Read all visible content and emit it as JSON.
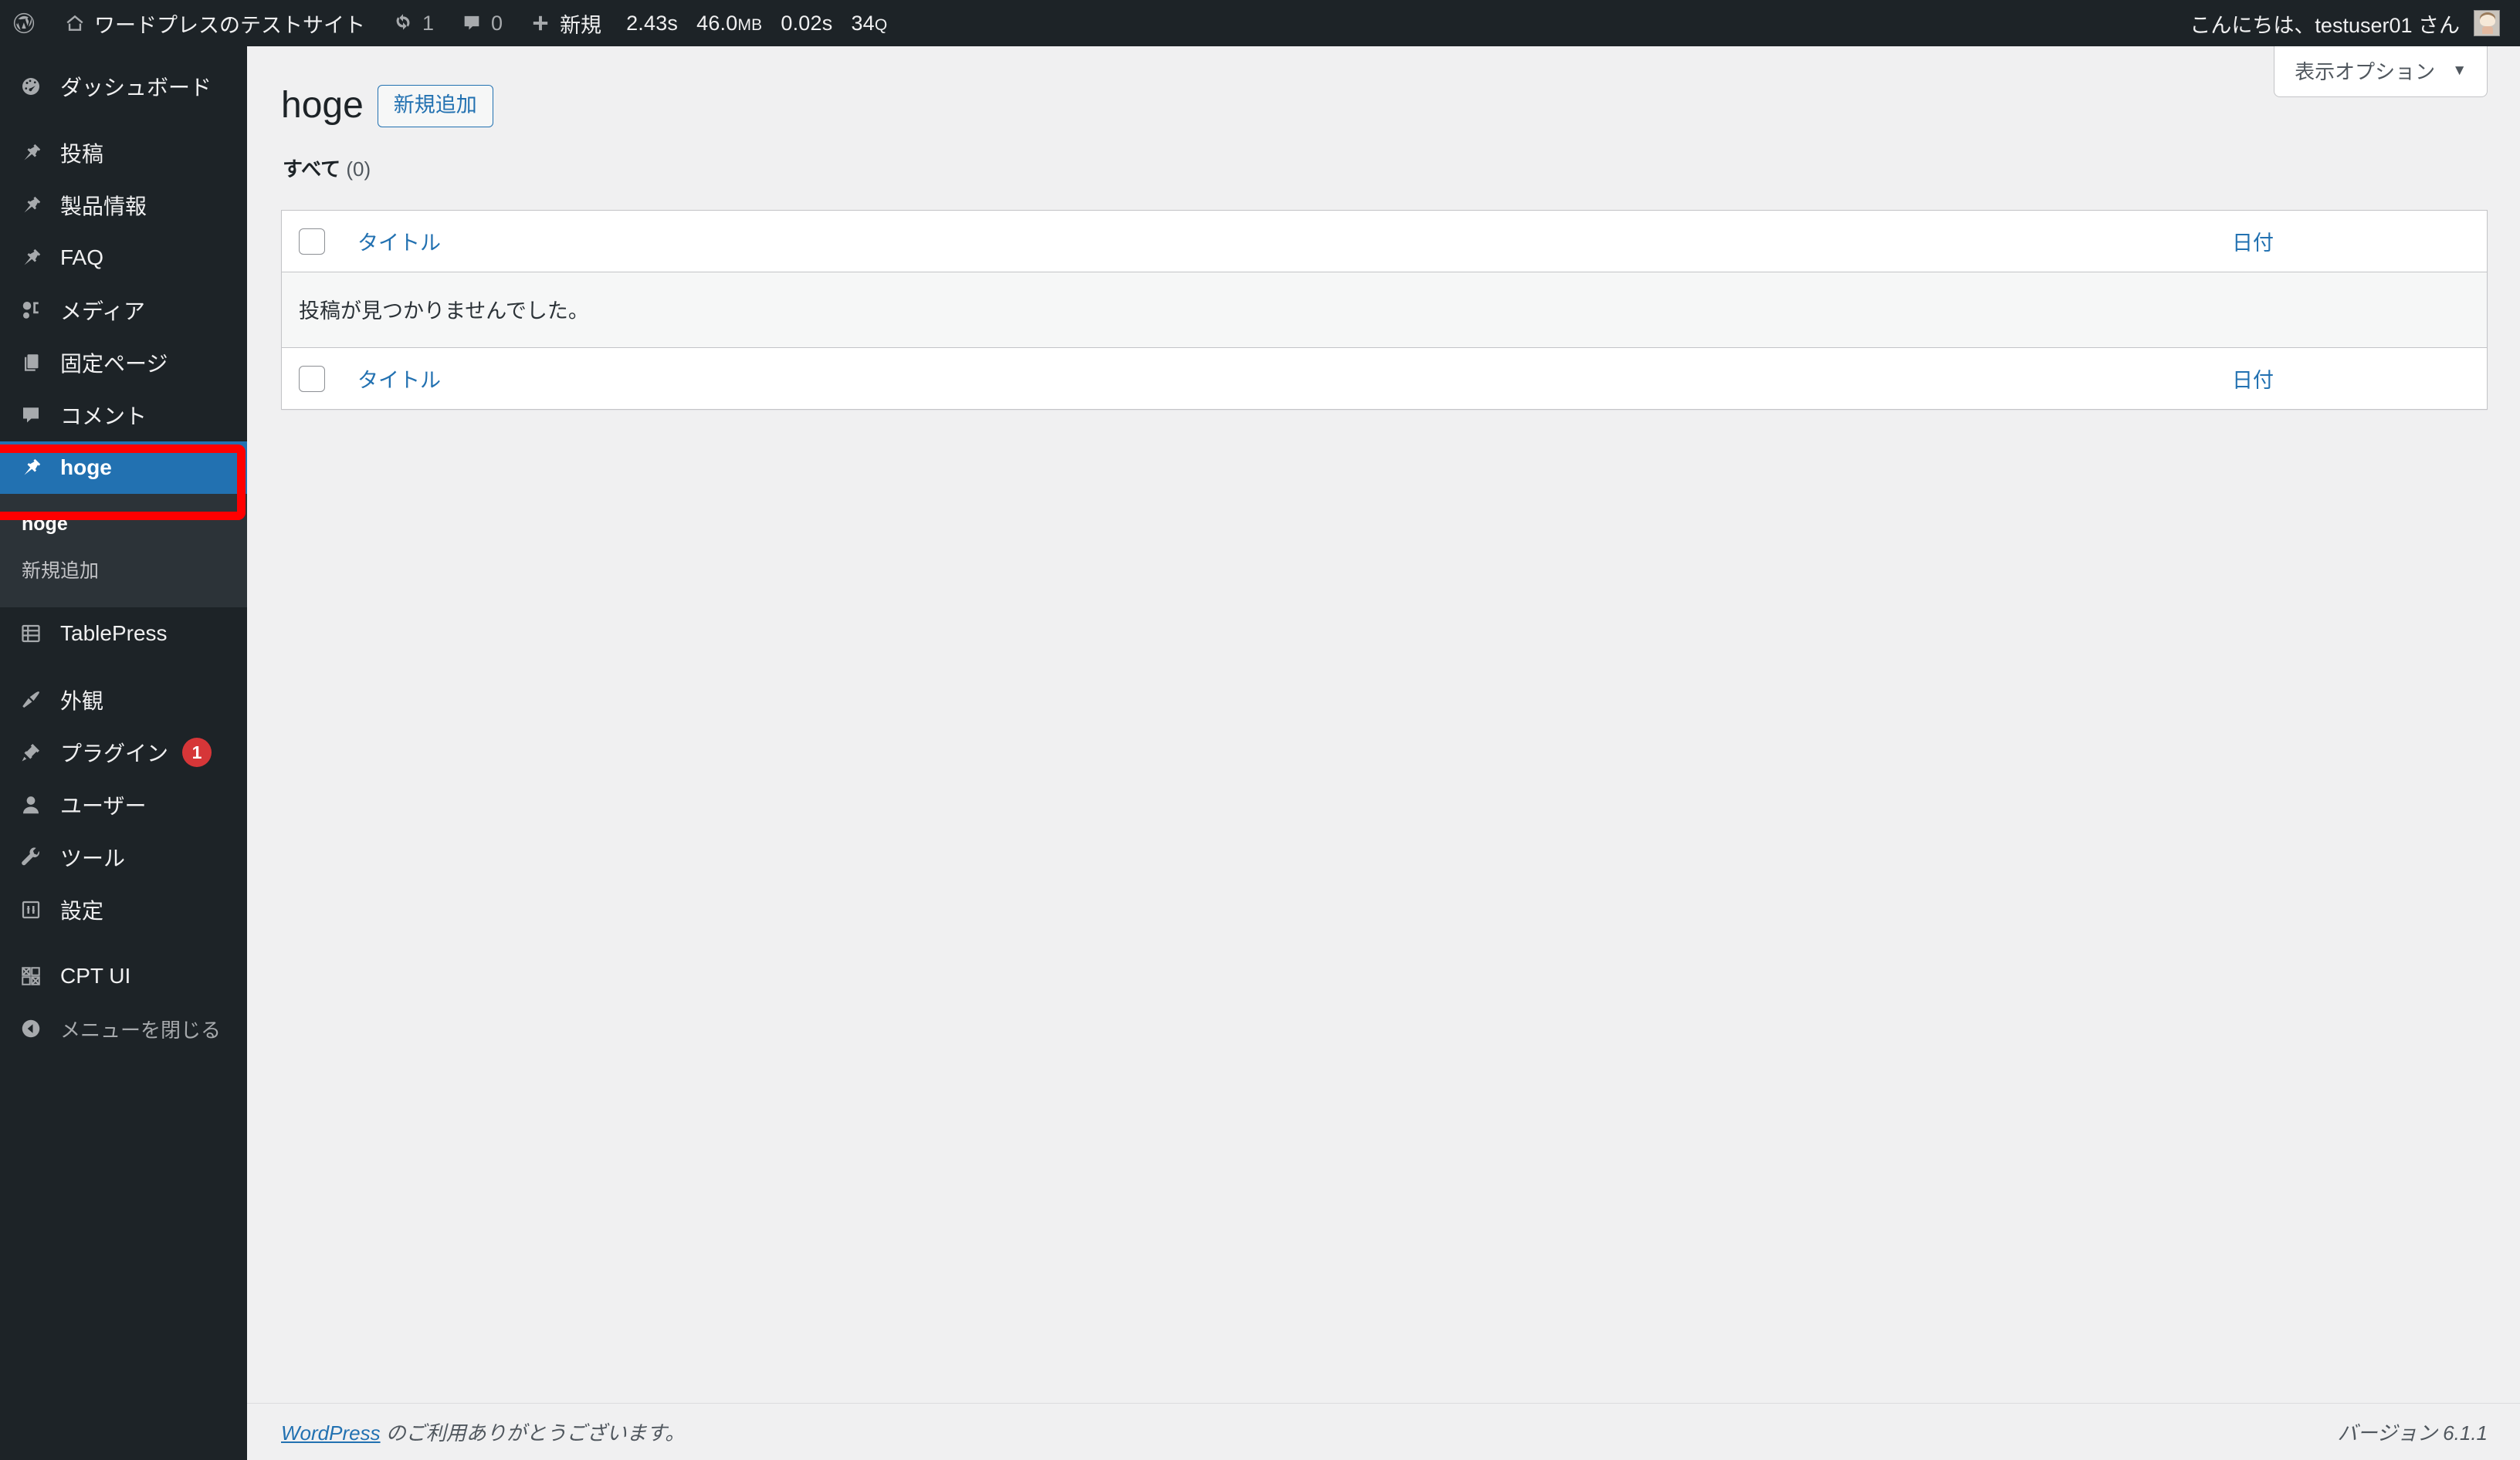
{
  "adminbar": {
    "wp_logo_icon": "wordpress-logo-icon",
    "site_home_icon": "home-icon",
    "site_name": "ワードプレスのテストサイト",
    "updates_icon": "update-arrows-icon",
    "updates_count": "1",
    "comments_icon": "comment-bubble-icon",
    "comments_count": "0",
    "new_icon": "plus-icon",
    "new_label": "新規",
    "perf": {
      "load_time": "2.43s",
      "memory": "46.0",
      "memory_unit": "MB",
      "query_time": "0.02s",
      "query_count": "34",
      "query_unit": "Q"
    },
    "greeting": "こんにちは、testuser01 さん",
    "avatar_name": "user-avatar"
  },
  "sidebar": {
    "items": [
      {
        "label": "ダッシュボード",
        "icon": "dashboard-icon",
        "name": "sidebar-item-dashboard"
      },
      {
        "label": "投稿",
        "icon": "pin-icon",
        "name": "sidebar-item-posts"
      },
      {
        "label": "製品情報",
        "icon": "pin-icon",
        "name": "sidebar-item-product-info"
      },
      {
        "label": "FAQ",
        "icon": "pin-icon",
        "name": "sidebar-item-faq"
      },
      {
        "label": "メディア",
        "icon": "media-icon",
        "name": "sidebar-item-media"
      },
      {
        "label": "固定ページ",
        "icon": "pages-icon",
        "name": "sidebar-item-pages"
      },
      {
        "label": "コメント",
        "icon": "comment-bubble-icon",
        "name": "sidebar-item-comments"
      },
      {
        "label": "hoge",
        "icon": "pin-icon",
        "name": "sidebar-item-hoge",
        "current": true
      },
      {
        "label": "TablePress",
        "icon": "table-icon",
        "name": "sidebar-item-tablepress"
      },
      {
        "label": "外観",
        "icon": "appearance-brush-icon",
        "name": "sidebar-item-appearance"
      },
      {
        "label": "プラグイン",
        "icon": "plugin-plug-icon",
        "name": "sidebar-item-plugins",
        "badge": "1"
      },
      {
        "label": "ユーザー",
        "icon": "user-icon",
        "name": "sidebar-item-users"
      },
      {
        "label": "ツール",
        "icon": "wrench-icon",
        "name": "sidebar-item-tools"
      },
      {
        "label": "設定",
        "icon": "settings-sliders-icon",
        "name": "sidebar-item-settings"
      },
      {
        "label": "CPT UI",
        "icon": "cpt-ui-grid-icon",
        "name": "sidebar-item-cpt-ui"
      }
    ],
    "hoge_submenu": [
      {
        "label": "hoge",
        "current": true
      },
      {
        "label": "新規追加",
        "current": false
      }
    ],
    "collapse": {
      "label": "メニューを閉じる",
      "icon": "collapse-arrow-icon"
    }
  },
  "screen_meta": {
    "show_options_label": "表示オプション",
    "caret": "▼"
  },
  "main": {
    "page_title": "hoge",
    "add_new_label": "新規追加",
    "filters": {
      "all_label": "すべて",
      "all_count": "(0)"
    },
    "table": {
      "columns": {
        "title": "タイトル",
        "date": "日付"
      },
      "no_items": "投稿が見つかりませんでした。",
      "rows": []
    }
  },
  "footer": {
    "thanks_link": "WordPress",
    "thanks_text": " のご利用ありがとうございます。",
    "version": "バージョン 6.1.1"
  },
  "colors": {
    "admin_bar_bg": "#1d2327",
    "sidebar_bg": "#1d2327",
    "submenu_bg": "#2c3338",
    "current_menu_bg": "#2271b1",
    "link_blue": "#2271b1",
    "badge_red": "#d63638",
    "annotation_red": "#ff0000",
    "content_bg": "#f0f0f1"
  }
}
